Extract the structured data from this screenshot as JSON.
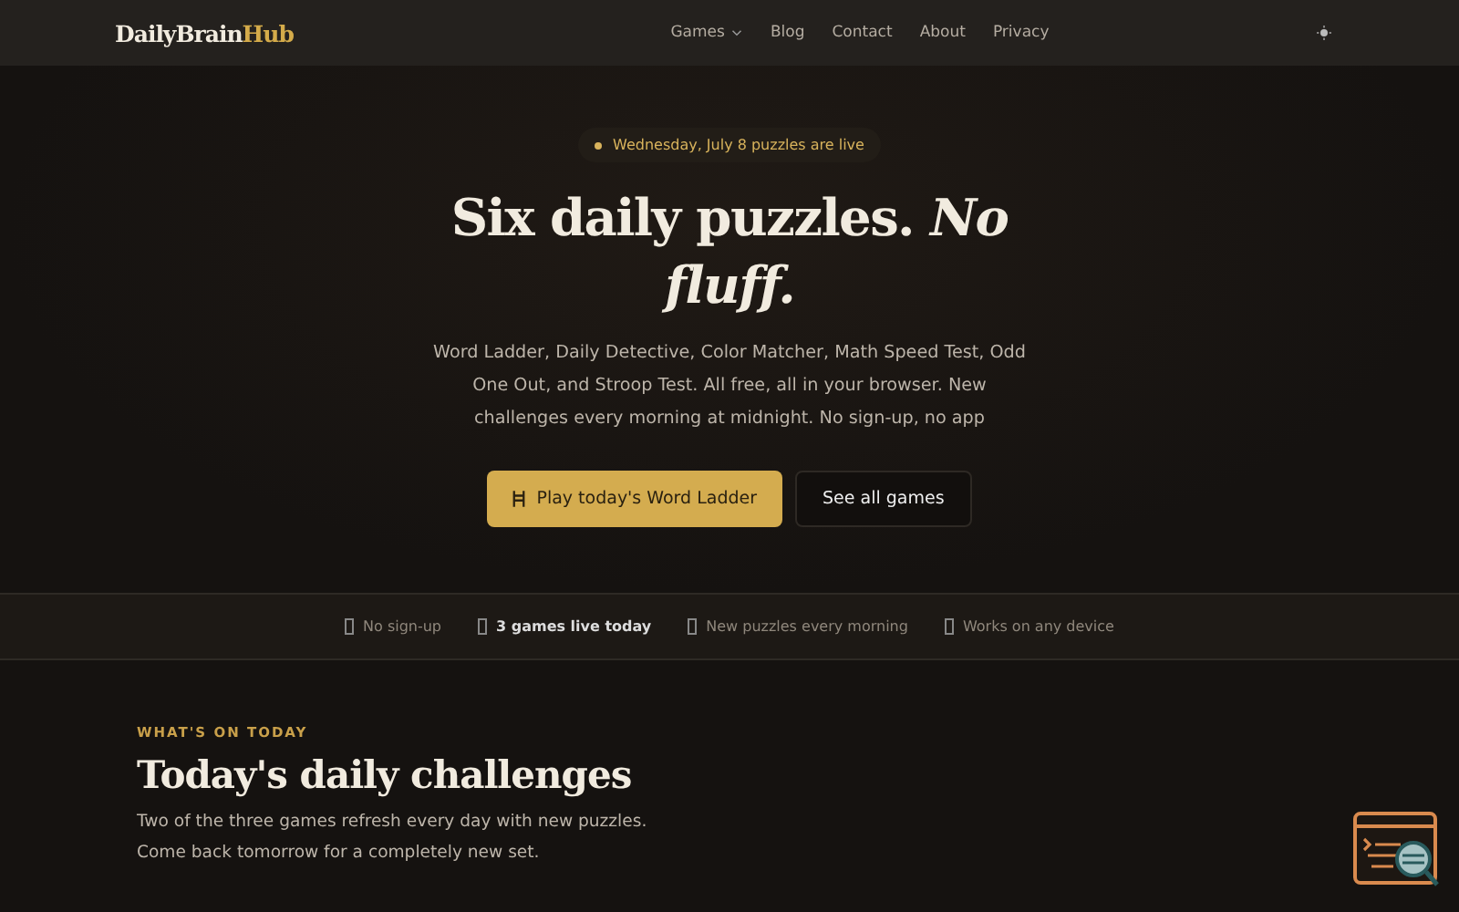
{
  "nav": {
    "logo_main": "DailyBrain",
    "logo_accent": "Hub",
    "links": [
      {
        "label": "Games",
        "kind": "dropdown"
      },
      {
        "label": "Blog",
        "kind": "link"
      },
      {
        "label": "Contact",
        "kind": "link"
      },
      {
        "label": "About",
        "kind": "link"
      },
      {
        "label": "Privacy",
        "kind": "link"
      }
    ]
  },
  "hero": {
    "badge": "Wednesday, July 8 puzzles are live",
    "title": "Six daily puzzles. *No fluff.*",
    "description": "Word Ladder, Daily Detective, Color Matcher, Math Speed Test, Odd One Out, and Stroop Test. All free, all in your browser. New challenges every morning at midnight. No sign-up, no app",
    "buttons": [
      {
        "label": "Play today's Word Ladder",
        "kind": "primary"
      },
      {
        "label": "See all games",
        "kind": "secondary"
      }
    ]
  },
  "trust_items": [
    {
      "label": "No sign-up",
      "bold": false
    },
    {
      "label": "3 games live today",
      "bold": true
    },
    {
      "label": "New puzzles every morning",
      "bold": false
    },
    {
      "label": "Works on any device",
      "bold": false
    }
  ],
  "section": {
    "eyebrow": "WHAT'S ON TODAY",
    "title": "Today's daily challenges",
    "description": "Two of the three games refresh every day with new puzzles. Come back tomorrow for a completely new set."
  }
}
